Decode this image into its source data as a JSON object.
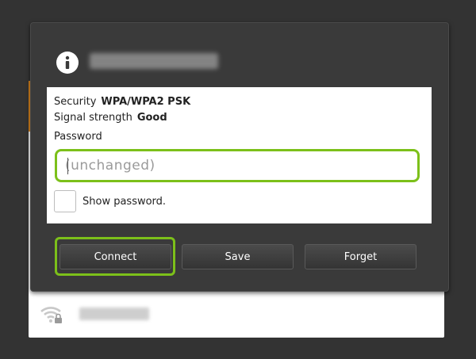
{
  "dialog": {
    "details": [
      {
        "label": "Security",
        "value": "WPA/WPA2 PSK"
      },
      {
        "label": "Signal strength",
        "value": "Good"
      }
    ],
    "password_label": "Password",
    "password_placeholder": "(unchanged)",
    "show_password_label": "Show password.",
    "show_password_checked": false,
    "buttons": {
      "connect": "Connect",
      "save": "Save",
      "forget": "Forget"
    },
    "accent_color": "#7cc01a"
  },
  "background_list": {
    "icon": "wifi-locked-icon"
  }
}
